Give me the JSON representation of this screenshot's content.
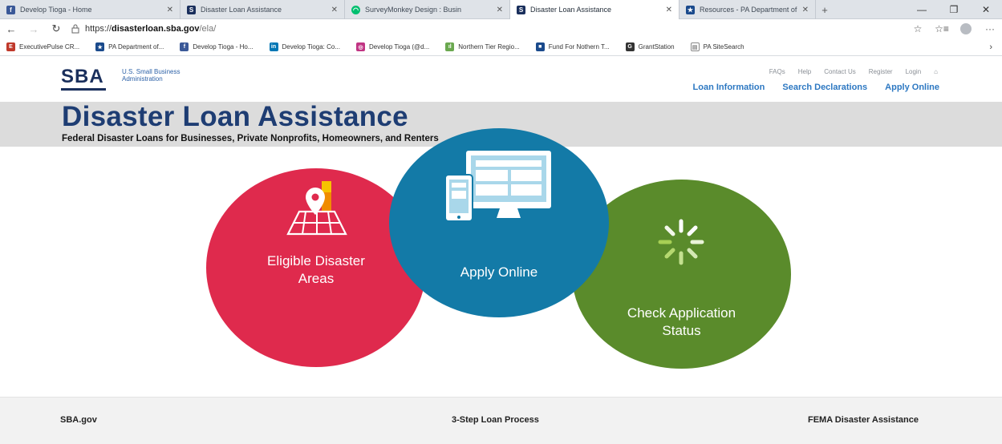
{
  "browser": {
    "tabs": [
      {
        "label": "Develop Tioga - Home",
        "favicon": "facebook-icon",
        "color": "#3b5998",
        "active": false
      },
      {
        "label": "Disaster Loan Assistance",
        "favicon": "sba-icon",
        "color": "#1a2f5c",
        "active": false
      },
      {
        "label": "SurveyMonkey Design : Busin",
        "favicon": "surveymonkey-icon",
        "color": "#00bf6f",
        "active": false
      },
      {
        "label": "Disaster Loan Assistance",
        "favicon": "sba-icon",
        "color": "#1a2f5c",
        "active": true
      },
      {
        "label": "Resources - PA Department of",
        "favicon": "pa-dept-icon",
        "color": "#1a4a8c",
        "active": false
      }
    ],
    "url": {
      "scheme": "https://",
      "host": "disasterloan.sba.gov",
      "path": "/ela/"
    },
    "favorites": [
      {
        "label": "ExecutivePulse CR...",
        "icon": "executivepulse-icon",
        "color": "#c0392b"
      },
      {
        "label": "PA Department of...",
        "icon": "pa-dept-icon",
        "color": "#1a4a8c"
      },
      {
        "label": "Develop Tioga - Ho...",
        "icon": "facebook-icon",
        "color": "#3b5998"
      },
      {
        "label": "Develop Tioga: Co...",
        "icon": "linkedin-icon",
        "color": "#0077b5"
      },
      {
        "label": "Develop Tioga (@d...",
        "icon": "instagram-icon",
        "color": "#c13584"
      },
      {
        "label": "Northern Tier Regio...",
        "icon": "chart-icon",
        "color": "#6aa84f"
      },
      {
        "label": "Fund For Nothern T...",
        "icon": "fund-icon",
        "color": "#1a4a8c"
      },
      {
        "label": "GrantStation",
        "icon": "grantstation-icon",
        "color": "#333333"
      },
      {
        "label": "PA SiteSearch",
        "icon": "document-icon",
        "color": "#888888"
      }
    ]
  },
  "site": {
    "logo": {
      "mark": "SBA",
      "line1": "U.S. Small Business",
      "line2": "Administration"
    },
    "utility": [
      "FAQs",
      "Help",
      "Contact Us",
      "Register",
      "Login"
    ],
    "nav": [
      "Loan Information",
      "Search Declarations",
      "Apply Online"
    ],
    "hero": {
      "title": "Disaster Loan Assistance",
      "subtitle": "Federal Disaster Loans for Businesses, Private Nonprofits, Homeowners, and Renters"
    },
    "circles": {
      "eligible": {
        "line1": "Eligible Disaster",
        "line2": "Areas",
        "color": "#df2a4d"
      },
      "apply": {
        "line1": "Apply Online",
        "color": "#137aa7"
      },
      "status": {
        "line1": "Check Application",
        "line2": "Status",
        "color": "#5a8b2b"
      }
    },
    "footer": [
      "SBA.gov",
      "3-Step Loan Process",
      "FEMA Disaster Assistance"
    ]
  }
}
